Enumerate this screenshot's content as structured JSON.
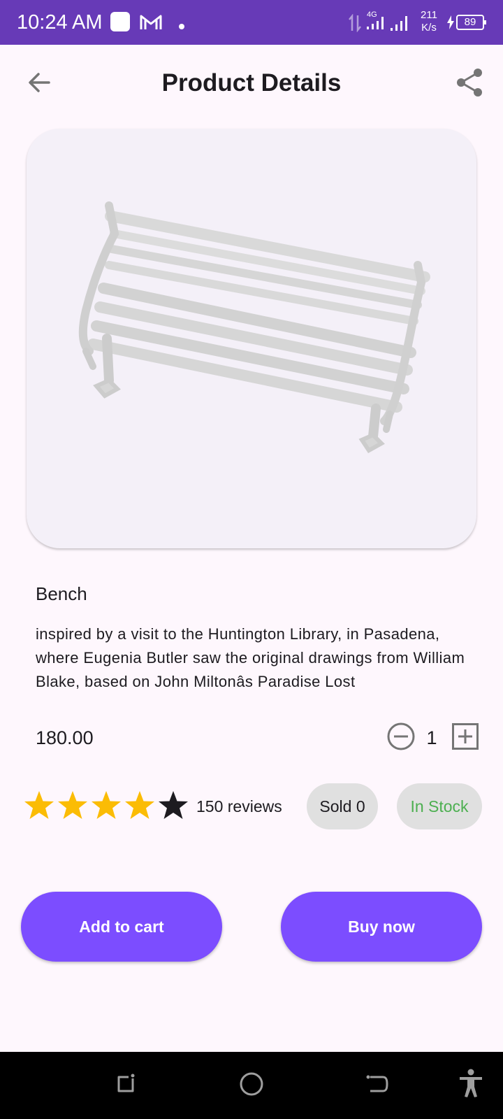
{
  "status_bar": {
    "time": "10:24 AM",
    "icons": [
      "notification-square-icon",
      "gmail-icon",
      "dot-icon",
      "data-arrows-icon",
      "signal-4g-icon",
      "signal-icon",
      "charging-icon"
    ],
    "net_speed_value": "211",
    "net_speed_unit": "K/s",
    "network_type": "4G",
    "battery": "89"
  },
  "app_bar": {
    "title": "Product Details",
    "back_icon": "arrow-left-icon",
    "share_icon": "share-icon"
  },
  "product": {
    "image": "bench-image",
    "name": "Bench",
    "description": "inspired by a visit to the Huntington Library, in Pasadena, where Eugenia Butler saw the original drawings from William Blake, based on John Miltonâs Paradise Lost",
    "price": "180.00",
    "quantity": "1",
    "rating": 4,
    "rating_max": 5,
    "reviews": "150 reviews",
    "sold": "Sold 0",
    "stock": "In Stock"
  },
  "actions": {
    "add_to_cart": "Add to cart",
    "buy_now": "Buy now"
  },
  "colors": {
    "status_bar": "#673ab7",
    "accent": "#7c4dff",
    "star_filled": "#fbbc05",
    "star_empty": "#1d1b20",
    "in_stock": "#4caf50",
    "chip": "#e0e0e0",
    "background": "#fef7fd"
  },
  "nav_bar": {
    "icons": [
      "recent-apps-icon",
      "home-icon",
      "back-icon",
      "accessibility-icon"
    ]
  }
}
